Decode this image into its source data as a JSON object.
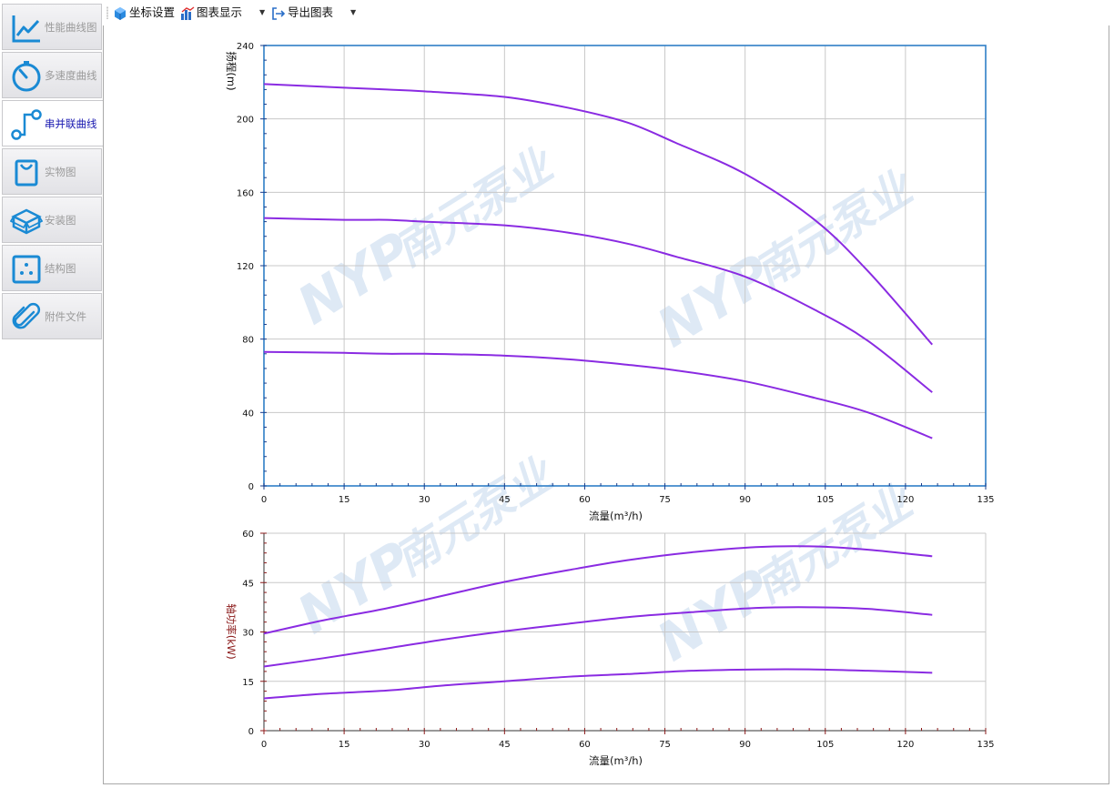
{
  "sidebar": {
    "items": [
      {
        "label": "性能曲线图",
        "icon": "line-chart-icon",
        "active": false
      },
      {
        "label": "多速度曲线",
        "icon": "speed-gauge-icon",
        "active": false
      },
      {
        "label": "串并联曲线",
        "icon": "series-parallel-icon",
        "active": true
      },
      {
        "label": "实物图",
        "icon": "product-photo-icon",
        "active": false
      },
      {
        "label": "安装图",
        "icon": "install-box-icon",
        "active": false
      },
      {
        "label": "结构图",
        "icon": "structure-icon",
        "active": false
      },
      {
        "label": "附件文件",
        "icon": "paperclip-icon",
        "active": false
      }
    ]
  },
  "toolbar": {
    "axis_settings": "坐标设置",
    "chart_display": "图表显示",
    "export_chart": "导出图表"
  },
  "colors": {
    "curve": "#8a2be2",
    "head_frame": "#2f7fc6",
    "grid": "#c8c8c8",
    "power_tick": "#8b1a1a",
    "watermark": "#b8d0ea",
    "accent_blue": "#1a8ad4"
  },
  "watermark": {
    "brand": "NYP",
    "name": "南元泵业"
  },
  "chart_data": [
    {
      "type": "line",
      "title": "",
      "xlabel": "流量(m³/h)",
      "ylabel": "扬程(m)",
      "xlim": [
        0,
        135
      ],
      "ylim": [
        0,
        240
      ],
      "xticks": [
        0,
        15,
        30,
        45,
        60,
        75,
        90,
        105,
        120,
        135
      ],
      "yticks": [
        0,
        40,
        80,
        120,
        160,
        200,
        240
      ],
      "grid": true,
      "series": [
        {
          "x": [
            0,
            15,
            23,
            30,
            45,
            57,
            68,
            77,
            90,
            103,
            113,
            125
          ],
          "y": [
            219,
            217,
            216,
            215,
            212,
            206,
            198,
            187,
            170,
            145,
            117,
            77
          ]
        },
        {
          "x": [
            0,
            15,
            23,
            30,
            45,
            57,
            68,
            77,
            90,
            103,
            113,
            125
          ],
          "y": [
            146,
            145,
            145,
            144,
            142,
            138,
            132,
            125,
            114,
            96,
            79,
            51
          ]
        },
        {
          "x": [
            0,
            15,
            23,
            30,
            45,
            57,
            68,
            77,
            90,
            103,
            113,
            125
          ],
          "y": [
            73,
            72.5,
            72,
            72,
            71,
            69,
            66,
            63,
            57,
            48,
            40,
            26
          ]
        }
      ]
    },
    {
      "type": "line",
      "title": "",
      "xlabel": "流量(m³/h)",
      "ylabel": "轴功率(kW)",
      "xlim": [
        0,
        135
      ],
      "ylim": [
        0,
        60
      ],
      "xticks": [
        0,
        15,
        30,
        45,
        60,
        75,
        90,
        105,
        120,
        135
      ],
      "yticks": [
        0,
        15,
        30,
        45,
        60
      ],
      "grid": true,
      "series": [
        {
          "x": [
            0,
            11,
            23,
            34,
            45,
            57,
            68,
            80,
            92,
            103,
            113,
            125
          ],
          "y": [
            29.5,
            33.5,
            37.2,
            41.2,
            45.2,
            48.8,
            51.8,
            54.2,
            55.8,
            56,
            55,
            53
          ]
        },
        {
          "x": [
            0,
            11,
            23,
            34,
            45,
            57,
            68,
            80,
            92,
            103,
            113,
            125
          ],
          "y": [
            19.5,
            22,
            25,
            27.8,
            30.2,
            32.5,
            34.5,
            36,
            37.3,
            37.5,
            37,
            35.2
          ]
        },
        {
          "x": [
            0,
            11,
            23,
            34,
            45,
            57,
            68,
            80,
            92,
            103,
            113,
            125
          ],
          "y": [
            9.8,
            11.2,
            12.2,
            13.8,
            15,
            16.4,
            17.2,
            18.2,
            18.6,
            18.6,
            18.2,
            17.6
          ]
        }
      ]
    }
  ]
}
